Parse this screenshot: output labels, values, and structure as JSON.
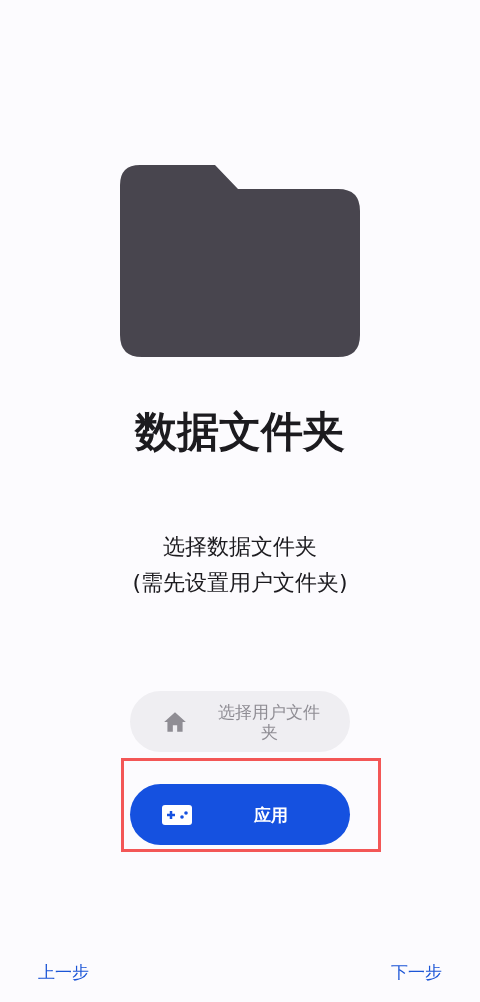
{
  "title": "数据文件夹",
  "description": [
    "选择数据文件夹",
    "(需先设置用户文件夹)"
  ],
  "buttons": [
    {
      "kind": "home",
      "label": "选择用户文件夹",
      "disabled": true,
      "highlighted": false
    },
    {
      "kind": "gamepad",
      "label": "应用",
      "disabled": false,
      "highlighted": true
    }
  ],
  "footer": {
    "back": "上一步",
    "next": "下一步"
  }
}
